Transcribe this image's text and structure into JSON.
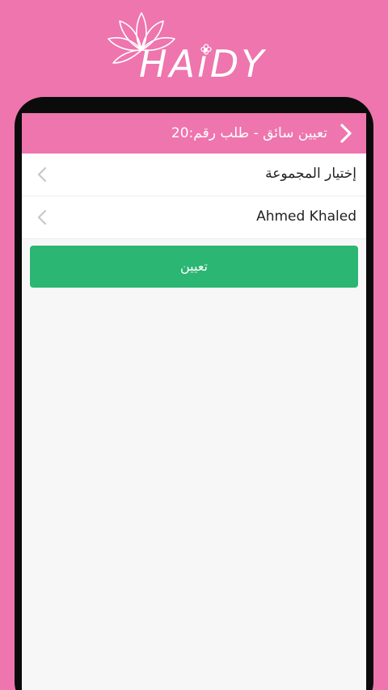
{
  "brand": {
    "logo_text": "HAiDY",
    "background_color": "#ee75ae",
    "logo_icon": "lotus-flower-icon"
  },
  "header": {
    "title": "تعيين سائق - طلب رقم:20",
    "back_icon": "chevron-back-icon",
    "color": "#ee75ae"
  },
  "list": {
    "items": [
      {
        "label": "إختيار المجموعة",
        "icon": "chevron-left-icon"
      },
      {
        "label": "Ahmed Khaled",
        "icon": "chevron-left-icon"
      }
    ]
  },
  "actions": {
    "assign_label": "تعيين",
    "assign_color": "#2bb673"
  }
}
